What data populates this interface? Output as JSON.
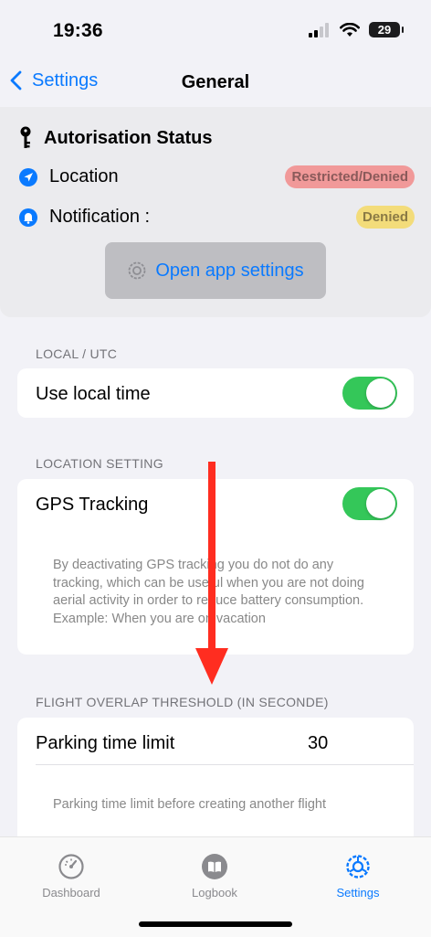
{
  "status_bar": {
    "time": "19:36",
    "battery": "29"
  },
  "nav": {
    "back_label": "Settings",
    "title": "General"
  },
  "authorisation": {
    "title": "Autorisation Status",
    "location_label": "Location",
    "location_status": "Restricted/Denied",
    "notification_label": "Notification :",
    "notification_status": "Denied",
    "open_settings_label": "Open app settings"
  },
  "local_utc": {
    "header": "LOCAL / UTC",
    "use_local_time_label": "Use local time",
    "use_local_time_on": true
  },
  "location_setting": {
    "header": "LOCATION SETTING",
    "gps_tracking_label": "GPS Tracking",
    "gps_tracking_on": true,
    "description": "By deactivating GPS tracking you do not do any tracking, which can be useful when you are not doing aerial activity in order to reduce battery consumption. Example: When you are on vacation"
  },
  "flight_overlap": {
    "header": "FLIGHT OVERLAP THRESHOLD (IN SECONDE)",
    "parking_label": "Parking time limit",
    "parking_value": "30",
    "description": "Parking time limit before creating another flight"
  },
  "tabbar": {
    "tabs": [
      {
        "label": "Dashboard",
        "icon": "speedometer-icon",
        "active": false
      },
      {
        "label": "Logbook",
        "icon": "book-icon",
        "active": false
      },
      {
        "label": "Settings",
        "icon": "gear-icon",
        "active": true
      }
    ]
  },
  "colors": {
    "accent": "#0a7aff",
    "toggle_on": "#34c759",
    "annotation_arrow": "#ff2d20"
  }
}
